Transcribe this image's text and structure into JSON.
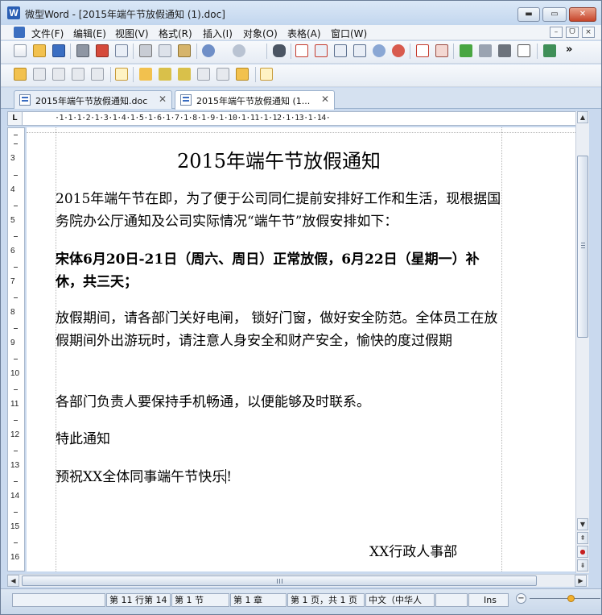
{
  "window": {
    "title": "微型Word - [2015年端午节放假通知 (1).doc]",
    "app_icon_letter": "W"
  },
  "window_controls": {
    "minimize": "▬",
    "maximize": "▭",
    "close": "✕"
  },
  "menu": {
    "items": [
      "文件(F)",
      "编辑(E)",
      "视图(V)",
      "格式(R)",
      "插入(I)",
      "对象(O)",
      "表格(A)",
      "窗口(W)"
    ],
    "mdi_buttons": [
      "–",
      "ᗜ",
      "×"
    ]
  },
  "toolbar1": {
    "icons": [
      "new-doc-icon",
      "open-folder-icon",
      "save-icon",
      "print-icon",
      "export-pdf-icon",
      "print-preview-icon",
      "cut-icon",
      "copy-icon",
      "paste-icon",
      "undo-icon",
      "redo-icon",
      "find-icon",
      "page-view-icon",
      "normal-view-icon",
      "outline-view-icon",
      "two-page-view-icon",
      "zoom-icon",
      "percent-icon",
      "font-icon",
      "paragraph-icon",
      "spellcheck-icon",
      "chart-icon",
      "shadow-icon",
      "frame-icon",
      "sync-icon"
    ],
    "overflow": "»"
  },
  "toolbar2": {
    "icons": [
      "highlight-icon",
      "edit-icon",
      "delete-icon",
      "refresh-icon",
      "link-icon",
      "layer-icon",
      "pen-icon",
      "marker-icon",
      "brush-icon",
      "eraser-icon",
      "scissors-icon",
      "note-icon",
      "comment-icon"
    ]
  },
  "tabs": [
    {
      "label": "2015年端午节放假通知.doc",
      "close": "✕"
    },
    {
      "label": "2015年端午节放假通知 (1...",
      "close": "✕"
    }
  ],
  "ruler": {
    "corner": "L",
    "text": "·1·1·1·2·1·3·1·4·1·5·1·6·1·7·1·8·1·9·1·10·1·11·1·12·1·13·1·14·",
    "vertical_numbers": [
      "3",
      "4",
      "5",
      "6",
      "7",
      "8",
      "9",
      "10",
      "11",
      "12",
      "13",
      "14",
      "15",
      "16"
    ]
  },
  "document": {
    "title": "2015年端午节放假通知",
    "para1": "2015年端午节在即，为了便于公司同仁提前安排好工作和生活，现根据国务院办公厅通知及公司实际情况“端午节”放假安排如下：",
    "para2": "宋体6月20日-21日（周六、周日）正常放假，6月22日（星期一）补休，共三天；",
    "para3": "放假期间，请各部门关好电闸，  锁好门窗，做好安全防范。全体员工在放假期间外出游玩时，请注意人身安全和财产安全，愉快的度过假期",
    "para4": "各部门负责人要保持手机畅通，以便能够及时联系。",
    "para5": "特此通知",
    "para6_before_caret": "预祝XX全体同事端午节快乐",
    "para6_after_caret": "!",
    "signature": "XX行政人事部"
  },
  "scrollbar": {
    "up": "▲",
    "down": "▼",
    "prev_page": "⇞",
    "select_browse": "●",
    "next_page": "⇟",
    "left": "◀",
    "right": "▶"
  },
  "status": {
    "position": "第 11 行第 14",
    "section": "第 1 节",
    "chapter": "第 1 章",
    "page": "第 1 页，共 1 页",
    "language": "中文（中华人",
    "mode": "Ins",
    "zoom_minus": "−"
  }
}
